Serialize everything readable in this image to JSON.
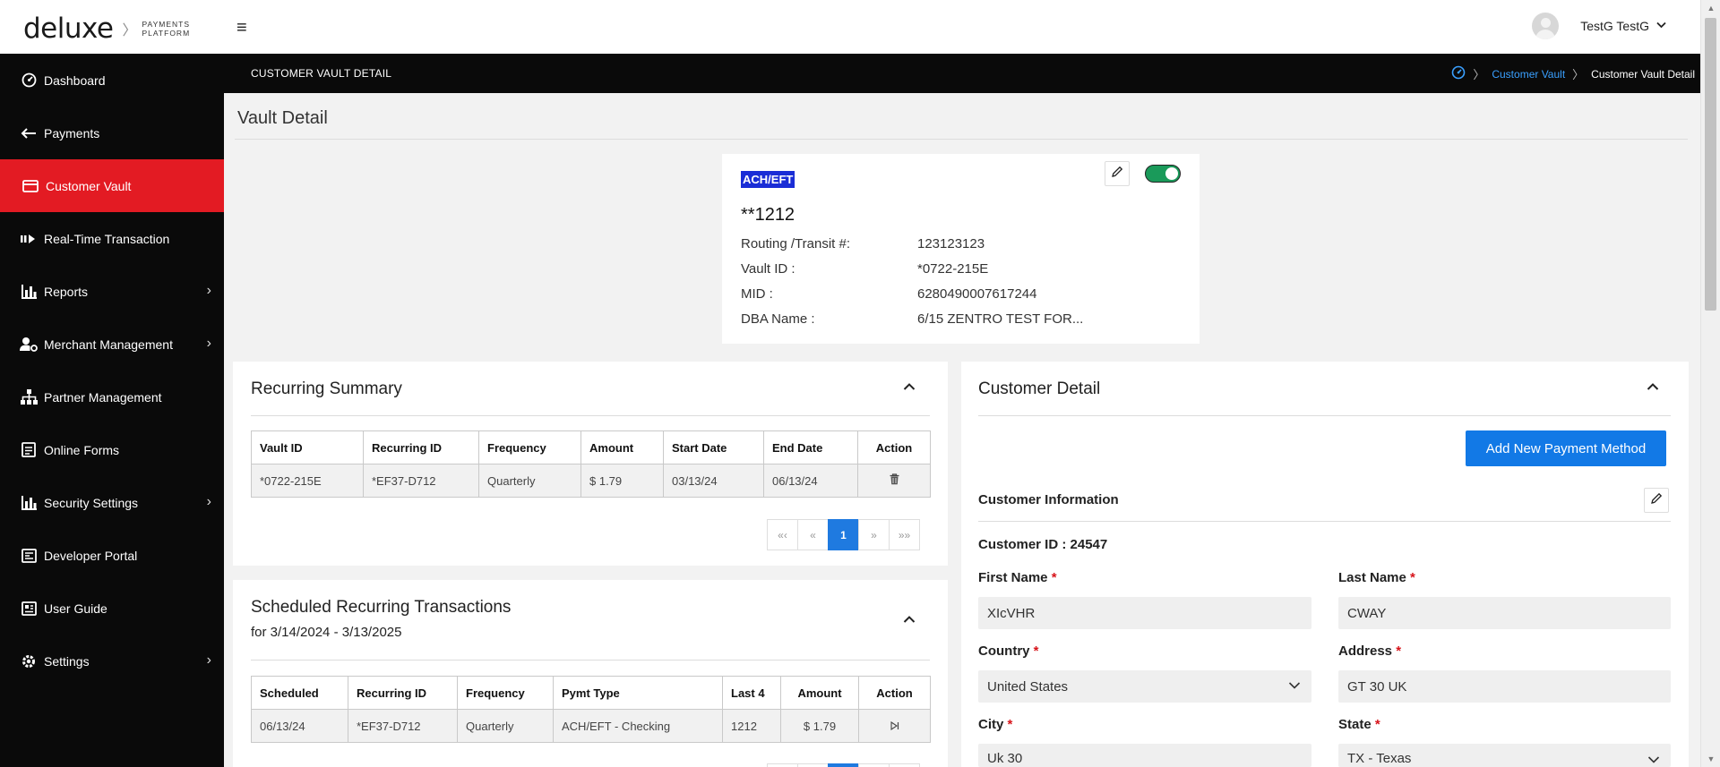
{
  "brand": {
    "word": "deluxe",
    "sub_line1": "PAYMENTS",
    "sub_line2": "PLATFORM"
  },
  "user": {
    "name": "TestG TestG"
  },
  "sidebar": {
    "items": [
      {
        "label": "Dashboard",
        "icon": "dashboard-icon"
      },
      {
        "label": "Payments",
        "icon": "payments-icon"
      },
      {
        "label": "Customer Vault",
        "icon": "card-icon",
        "active": true
      },
      {
        "label": "Real-Time Transaction",
        "icon": "realtime-icon"
      },
      {
        "label": "Reports",
        "icon": "bar-chart-icon",
        "has_children": true
      },
      {
        "label": "Merchant Management",
        "icon": "user-gear-icon",
        "has_children": true
      },
      {
        "label": "Partner Management",
        "icon": "org-chart-icon"
      },
      {
        "label": "Online Forms",
        "icon": "form-icon"
      },
      {
        "label": "Security Settings",
        "icon": "bar-chart-icon",
        "has_children": true
      },
      {
        "label": "Developer Portal",
        "icon": "developer-icon"
      },
      {
        "label": "User Guide",
        "icon": "guide-icon"
      },
      {
        "label": "Settings",
        "icon": "gear-icon",
        "has_children": true
      }
    ]
  },
  "header_strip": {
    "title": "CUSTOMER VAULT DETAIL",
    "breadcrumb": {
      "link": "Customer Vault",
      "current": "Customer Vault Detail"
    }
  },
  "page": {
    "title": "Vault Detail"
  },
  "vault_card": {
    "type_badge": "ACH/EFT",
    "masked_account": "**1212",
    "rows": [
      {
        "label": "Routing /Transit #:",
        "value": "123123123"
      },
      {
        "label": "Vault ID :",
        "value": "*0722-215E"
      },
      {
        "label": "MID :",
        "value": "6280490007617244"
      },
      {
        "label": "DBA Name :",
        "value": "6/15 ZENTRO TEST FOR..."
      }
    ],
    "enabled": true
  },
  "recurring_summary": {
    "title": "Recurring Summary",
    "columns": [
      "Vault ID",
      "Recurring ID",
      "Frequency",
      "Amount",
      "Start Date",
      "End Date",
      "Action"
    ],
    "rows": [
      [
        "*0722-215E",
        "*EF37-D712",
        "Quarterly",
        "$ 1.79",
        "03/13/24",
        "06/13/24"
      ]
    ],
    "pager": {
      "first": "«‹",
      "prev": "«",
      "current": "1",
      "next": "»",
      "last": "»»"
    }
  },
  "scheduled": {
    "title": "Scheduled Recurring Transactions",
    "subtitle": "for 3/14/2024 - 3/13/2025",
    "columns": [
      "Scheduled",
      "Recurring ID",
      "Frequency",
      "Pymt Type",
      "Last 4",
      "Amount",
      "Action"
    ],
    "rows": [
      [
        "06/13/24",
        "*EF37-D712",
        "Quarterly",
        "ACH/EFT - Checking",
        "1212",
        "$ 1.79"
      ]
    ]
  },
  "customer_detail": {
    "title": "Customer Detail",
    "add_button": "Add New Payment Method",
    "info_heading": "Customer Information",
    "customer_id_label": "Customer ID :",
    "customer_id": "24547",
    "fields": {
      "first_name": {
        "label": "First Name",
        "value": "XIcVHR"
      },
      "last_name": {
        "label": "Last Name",
        "value": "CWAY"
      },
      "country": {
        "label": "Country",
        "value": "United States"
      },
      "address": {
        "label": "Address",
        "value": "GT 30 UK"
      },
      "city": {
        "label": "City",
        "value": "Uk 30"
      },
      "state": {
        "label": "State",
        "value": "TX - Texas"
      }
    },
    "required_mark": "*"
  }
}
